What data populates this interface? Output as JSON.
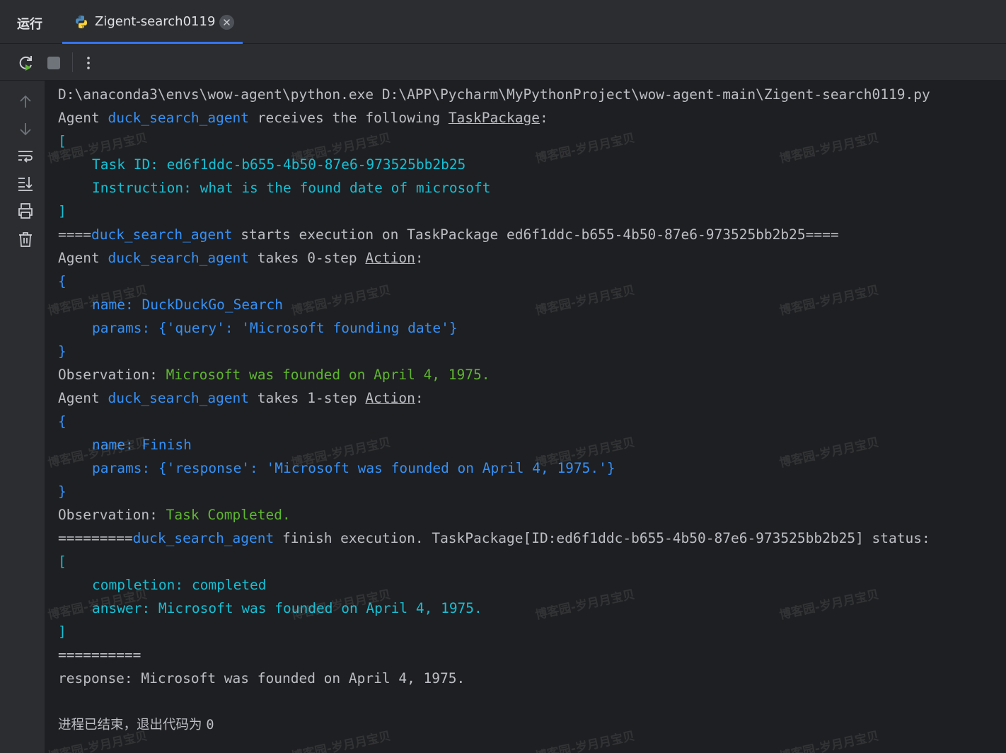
{
  "tabbar": {
    "run_label": "运行",
    "tab_label": "Zigent-search0119"
  },
  "console": {
    "cmd": "D:\\anaconda3\\envs\\wow-agent\\python.exe D:\\APP\\Pycharm\\MyPythonProject\\wow-agent-main\\Zigent-search0119.py",
    "word_agent": "Agent ",
    "agent_name": "duck_search_agent",
    "receives": " receives the following ",
    "taskpackage": "TaskPackage",
    "colon": ":",
    "bracket_open": "[",
    "bracket_close": "]",
    "brace_open": "{",
    "brace_close": "}",
    "task_id_line": "Task ID: ed6f1ddc-b655-4b50-87e6-973525bb2b25",
    "instruction_line": "Instruction: what is the found date of microsoft",
    "eq4": "====",
    "starts_text": " starts execution on TaskPackage ed6f1ddc-b655-4b50-87e6-973525bb2b25====",
    "takes_0": " takes 0-step ",
    "takes_1": " takes 1-step ",
    "action": "Action",
    "name_key": "name: ",
    "params_key": "params: ",
    "step0_name": "DuckDuckGo_Search",
    "step0_params": "{'query': 'Microsoft founding date'}",
    "observation_key": "Observation: ",
    "obs0": "Microsoft was founded on April 4, 1975.",
    "step1_name": "Finish",
    "step1_params": "{'response': 'Microsoft was founded on April 4, 1975.'}",
    "obs1": "Task Completed.",
    "eq9": "=========",
    "finish_text": " finish execution. TaskPackage[ID:ed6f1ddc-b655-4b50-87e6-973525bb2b25] status:",
    "completion_line": "completion: completed",
    "answer_line": "answer: Microsoft was founded on April 4, 1975.",
    "eq10": "==========",
    "response_line": "response: Microsoft was founded on April 4, 1975.",
    "exit_text": "进程已结束，退出代码为 ",
    "exit_code": "0"
  },
  "watermark": "博客园-岁月月宝贝",
  "colors": {
    "background": "#1e1f22",
    "panel": "#2b2d30",
    "text": "#bcbec4",
    "blue": "#3591f7",
    "cyan": "#17bfd4",
    "green": "#5fb631",
    "tab_underline": "#3574f0"
  },
  "icons": {
    "tab": "python-icon",
    "close": "close-icon",
    "toolbar": [
      "rerun-icon",
      "stop-icon",
      "more-vertical-icon"
    ],
    "gutter": [
      "arrow-up-icon",
      "arrow-down-icon",
      "soft-wrap-icon",
      "scroll-to-end-icon",
      "print-icon",
      "trash-icon"
    ]
  }
}
